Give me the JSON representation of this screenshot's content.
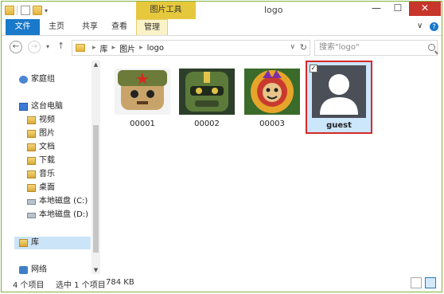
{
  "window": {
    "title": "logo",
    "contextual_tab_group": "图片工具",
    "controls": {
      "minimize": "—",
      "maximize": "☐",
      "close": "✕"
    }
  },
  "ribbon": {
    "tabs": [
      {
        "label": "文件"
      },
      {
        "label": "主页"
      },
      {
        "label": "共享"
      },
      {
        "label": "查看"
      },
      {
        "label": "管理"
      }
    ],
    "collapse_icon": "∨",
    "help_icon": "?"
  },
  "navigation": {
    "back_icon": "←",
    "forward_icon": "→",
    "recent_icon": "▾",
    "up_icon": "↑",
    "address": {
      "separator": "▸",
      "segments": [
        "库",
        "图片",
        "logo"
      ],
      "dropdown_icon": "∨",
      "refresh_icon": "↻"
    },
    "search": {
      "placeholder": "搜索\"logo\""
    }
  },
  "nav_pane": {
    "homegroup": "家庭组",
    "this_pc": "这台电脑",
    "pc_items": [
      "视频",
      "图片",
      "文档",
      "下载",
      "音乐",
      "桌面",
      "本地磁盘 (C:)",
      "本地磁盘 (D:)"
    ],
    "libraries": "库",
    "network": "网络"
  },
  "files": [
    {
      "name": "00001"
    },
    {
      "name": "00002"
    },
    {
      "name": "00003"
    },
    {
      "name": "guest",
      "selected": true
    }
  ],
  "status": {
    "count": "4 个项目",
    "selection": "选中 1 个项目",
    "size": "784 KB"
  },
  "colors": {
    "accent": "#1979ca",
    "context_tab": "#e6c83d",
    "selection_border": "#d42a2a",
    "selection_fill": "#cce6fb",
    "close_button": "#c7352b"
  }
}
